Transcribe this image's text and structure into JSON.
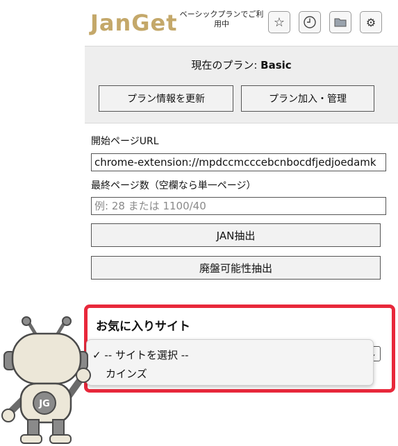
{
  "header": {
    "logo": "JanGet",
    "plan_note": "ベーシックプランでご利用中",
    "icons": [
      "star-icon",
      "clock-icon",
      "folder-icon",
      "gear-icon"
    ]
  },
  "plan": {
    "label": "現在のプラン: ",
    "name": "Basic",
    "refresh_button": "プラン情報を更新",
    "manage_button": "プラン加入・管理"
  },
  "form": {
    "start_url_label": "開始ページURL",
    "start_url_value": "chrome-extension://mpdccmcccebcnbocdfjedjoedamk",
    "last_page_label": "最終ページ数（空欄なら単一ページ）",
    "last_page_placeholder": "例: 28 または 1100/40",
    "jan_button": "JAN抽出",
    "discontinued_button": "廃盤可能性抽出"
  },
  "favorites": {
    "title": "お気に入りサイト",
    "options": [
      {
        "label": "-- サイトを選択 --",
        "selected": true
      },
      {
        "label": "カインズ",
        "selected": false
      }
    ],
    "check_mark": "✓"
  },
  "mascot": {
    "badge": "JG"
  },
  "colors": {
    "highlight_border": "#e8283b",
    "plan_panel_bg": "#eeeeee",
    "logo_gold": "#c4a86a"
  }
}
